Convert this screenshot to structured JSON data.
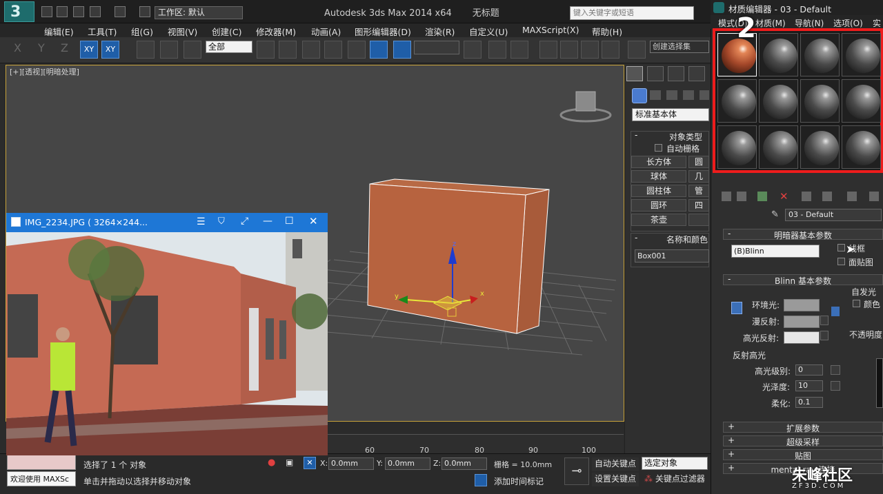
{
  "app": {
    "title": "Autodesk 3ds Max  2014 x64",
    "document": "无标题",
    "workspace": "工作区: 默认",
    "search_placeholder": "键入关键字或短语"
  },
  "menu": [
    "编辑(E)",
    "工具(T)",
    "组(G)",
    "视图(V)",
    "创建(C)",
    "修改器(M)",
    "动画(A)",
    "图形编辑器(D)",
    "渲染(R)",
    "自定义(U)",
    "MAXScript(X)",
    "帮助(H)"
  ],
  "toolbar": {
    "axis_xy": "XY",
    "axis_xy2": "XY",
    "selection_filter": "全部",
    "named_selection": "创建选择集"
  },
  "viewport": {
    "label": "[+][透视][明暗处理]",
    "axis_x": "x",
    "axis_y": "y",
    "axis_z": "z"
  },
  "timeline": {
    "ticks": [
      "60",
      "70",
      "80",
      "90",
      "100"
    ]
  },
  "status": {
    "welcome": "欢迎使用 MAXSc",
    "selected": "选择了 1 个 对象",
    "prompt": "单击并拖动以选择并移动对象",
    "x_label": "X:",
    "x_value": "0.0mm",
    "y_label": "Y:",
    "y_value": "0.0mm",
    "z_label": "Z:",
    "z_value": "0.0mm",
    "grid": "栅格 = 10.0mm",
    "add_time_tag": "添加时间标记",
    "auto_key": "自动关键点",
    "set_key": "设置关键点",
    "selected_obj": "选定对象",
    "key_filters": "关键点过滤器"
  },
  "command_panel": {
    "primitive_type": "标准基本体",
    "object_type": "对象类型",
    "autogrid": "自动栅格",
    "buttons": [
      "长方体",
      "球体",
      "圆柱体",
      "圆环",
      "茶壶"
    ],
    "buttons_right": [
      "圆",
      "几",
      "管",
      "四",
      ""
    ],
    "name_color": "名称和颜色",
    "object_name": "Box001"
  },
  "image_viewer": {
    "title": "IMG_2234.JPG ( 3264×244..."
  },
  "material_editor": {
    "title": "材质编辑器 - 03 - Default",
    "menu": [
      "模式(D)",
      "材质(M)",
      "导航(N)",
      "选项(O)",
      "实用"
    ],
    "material_name": "03 - Default",
    "shader_rollout": "明暗器基本参数",
    "shader": "(B)Blinn",
    "wire": "线框",
    "face_map": "面贴图",
    "blinn_rollout": "Blinn 基本参数",
    "self_illum": "自发光",
    "color": "颜色",
    "ambient": "环境光:",
    "diffuse": "漫反射:",
    "specular": "高光反射:",
    "opacity": "不透明度",
    "spec_highlights": "反射高光",
    "spec_level": "高光级别:",
    "spec_level_value": "0",
    "glossiness": "光泽度:",
    "glossiness_value": "10",
    "soften": "柔化:",
    "soften_value": "0.1",
    "extended": "扩展参数",
    "supersampling": "超级采样",
    "maps": "贴图",
    "mental_ray": "mental ray 连接"
  },
  "watermark": {
    "brand": "朱峰社区",
    "url": "ZF3D.COM"
  },
  "colors": {
    "accent": "#1e77d6",
    "highlight": "#ee1c1c",
    "box": "#b7633f",
    "viewport_border": "#c8a33a"
  }
}
